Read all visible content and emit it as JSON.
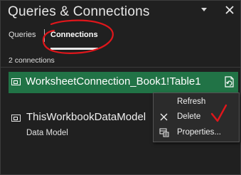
{
  "pane": {
    "title": "Queries & Connections"
  },
  "tabs": [
    {
      "label": "Queries",
      "active": false
    },
    {
      "label": "Connections",
      "active": true
    }
  ],
  "connections_count": "2 connections",
  "connections": [
    {
      "name": "WorksheetConnection_Book1!Table1",
      "subtitle": "",
      "selected": true
    },
    {
      "name": "ThisWorkbookDataModel",
      "subtitle": "Data Model",
      "selected": false
    }
  ],
  "context_menu": {
    "items": [
      {
        "label": "Refresh",
        "icon": ""
      },
      {
        "label": "Delete",
        "icon": "x-icon"
      },
      {
        "label": "Properties...",
        "icon": "properties-icon"
      }
    ]
  },
  "colors": {
    "background": "#202020",
    "selected_row": "#217346",
    "menu_background": "#2b2b2b",
    "annotation": "#e0161b"
  }
}
